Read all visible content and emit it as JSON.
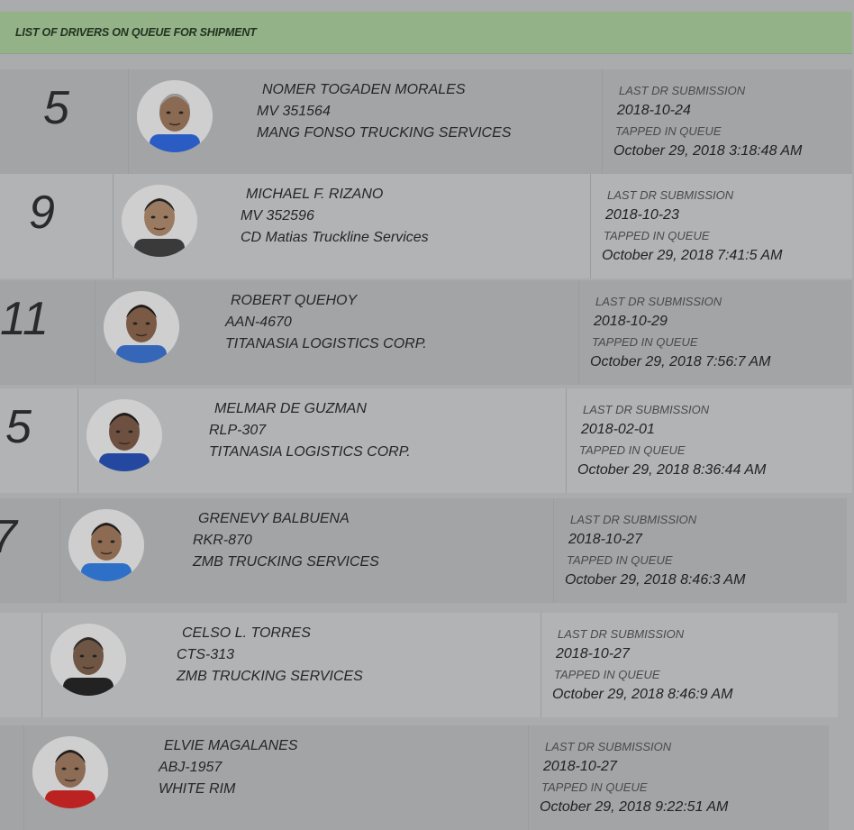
{
  "header": {
    "title": "LIST OF DRIVERS ON QUEUE FOR SHIPMENT"
  },
  "labels": {
    "last_dr": "LAST DR SUBMISSION",
    "tapped": "TAPPED IN QUEUE"
  },
  "drivers": [
    {
      "queue_no": "5",
      "name": "NOMER TOGADEN MORALES",
      "plate": "MV 351564",
      "company": "MANG FONSO TRUCKING SERVICES",
      "last_dr": "2018-10-24",
      "tapped": "October 29, 2018 3:18:48 AM"
    },
    {
      "queue_no": "9",
      "name": "MICHAEL F. RIZANO",
      "plate": "MV 352596",
      "company": "CD Matias Truckline Services",
      "last_dr": "2018-10-23",
      "tapped": "October 29, 2018 7:41:5 AM"
    },
    {
      "queue_no": "11",
      "name": "ROBERT QUEHOY",
      "plate": "AAN-4670",
      "company": "TITANASIA LOGISTICS CORP.",
      "last_dr": "2018-10-29",
      "tapped": "October 29, 2018 7:56:7 AM"
    },
    {
      "queue_no": "5",
      "name": "MELMAR DE GUZMAN",
      "plate": "RLP-307",
      "company": "TITANASIA LOGISTICS CORP.",
      "last_dr": "2018-02-01",
      "tapped": "October 29, 2018 8:36:44 AM"
    },
    {
      "queue_no": "7",
      "name": "GRENEVY BALBUENA",
      "plate": "RKR-870",
      "company": "ZMB TRUCKING SERVICES",
      "last_dr": "2018-10-27",
      "tapped": "October 29, 2018 8:46:3 AM"
    },
    {
      "queue_no": "",
      "name": "CELSO L. TORRES",
      "plate": "CTS-313",
      "company": "ZMB TRUCKING SERVICES",
      "last_dr": "2018-10-27",
      "tapped": "October 29, 2018 8:46:9 AM"
    },
    {
      "queue_no": "",
      "name": "ELVIE MAGALANES",
      "plate": "ABJ-1957",
      "company": "WHITE RIM",
      "last_dr": "2018-10-27",
      "tapped": "October 29, 2018 9:22:51 AM"
    }
  ],
  "colors": {
    "header_bg": "#93b287",
    "row_dark": "#a2a4a6",
    "row_light": "#b1b3b5"
  },
  "icons": {
    "avatar": "driver-photo"
  }
}
